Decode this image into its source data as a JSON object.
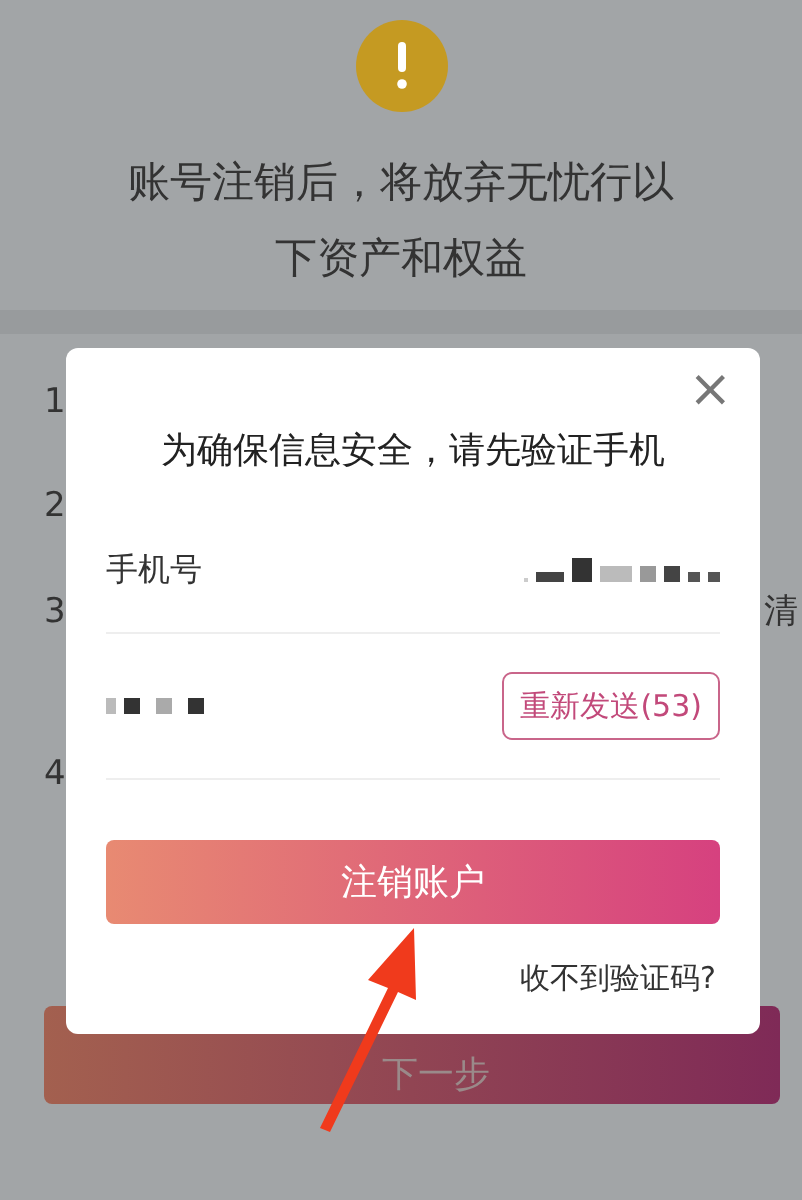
{
  "page": {
    "warning_title": "账号注销后，将放弃无忧行以下资产和权益",
    "list": [
      {
        "marker": "1"
      },
      {
        "marker": "2"
      },
      {
        "marker": "3",
        "end_text": "清"
      },
      {
        "marker": "4"
      }
    ],
    "next_button": "下一步"
  },
  "dialog": {
    "title": "为确保信息安全，请先验证手机",
    "close": "×",
    "phone_label": "手机号",
    "resend_button": "重新发送(53)",
    "confirm_button": "注销账户",
    "help_link": "收不到验证码?"
  }
}
